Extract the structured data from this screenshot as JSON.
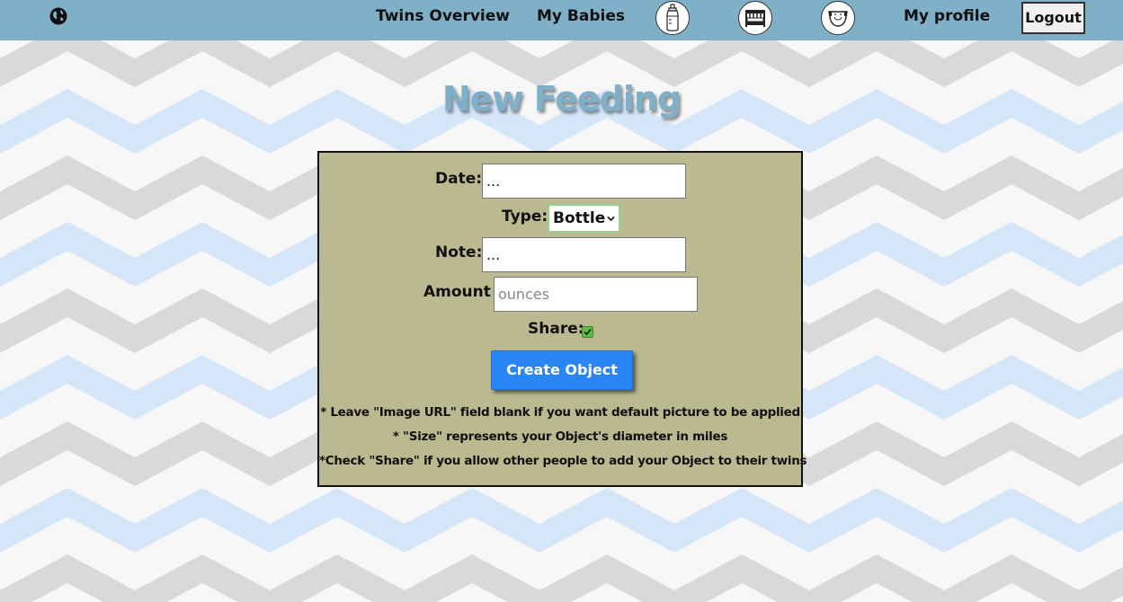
{
  "colors": {
    "navbar": "#7fb0c8",
    "title": "#7fb0c8",
    "form_bg": "#bbb98f",
    "button": "#2b86f5",
    "chevron_gray": "#d9d9d9",
    "chevron_blue": "#d5e6f8"
  },
  "nav": {
    "globe_icon": "globe-icon",
    "links": [
      {
        "label": "Twins Overview"
      },
      {
        "label": "My Babies"
      }
    ],
    "icons": [
      "baby-bottle-icon",
      "crib-icon",
      "diaper-icon"
    ],
    "profile_label": "My profile",
    "logout_label": "Logout"
  },
  "page": {
    "title": "New Feeding"
  },
  "form": {
    "date": {
      "label": "Date:",
      "value": "..."
    },
    "type": {
      "label": "Type:",
      "selected": "Bottle"
    },
    "note": {
      "label": "Note:",
      "value": "..."
    },
    "amount": {
      "label": "Amount",
      "placeholder": "ounces"
    },
    "share": {
      "label": "Share:",
      "checked": true
    },
    "submit_label": "Create Object",
    "notes": [
      "* Leave \"Image URL\" field blank if you want default picture to be applied",
      "* \"Size\" represents your Object's diameter in miles",
      "*Check \"Share\" if you allow other people to add your Object to their twins"
    ]
  }
}
